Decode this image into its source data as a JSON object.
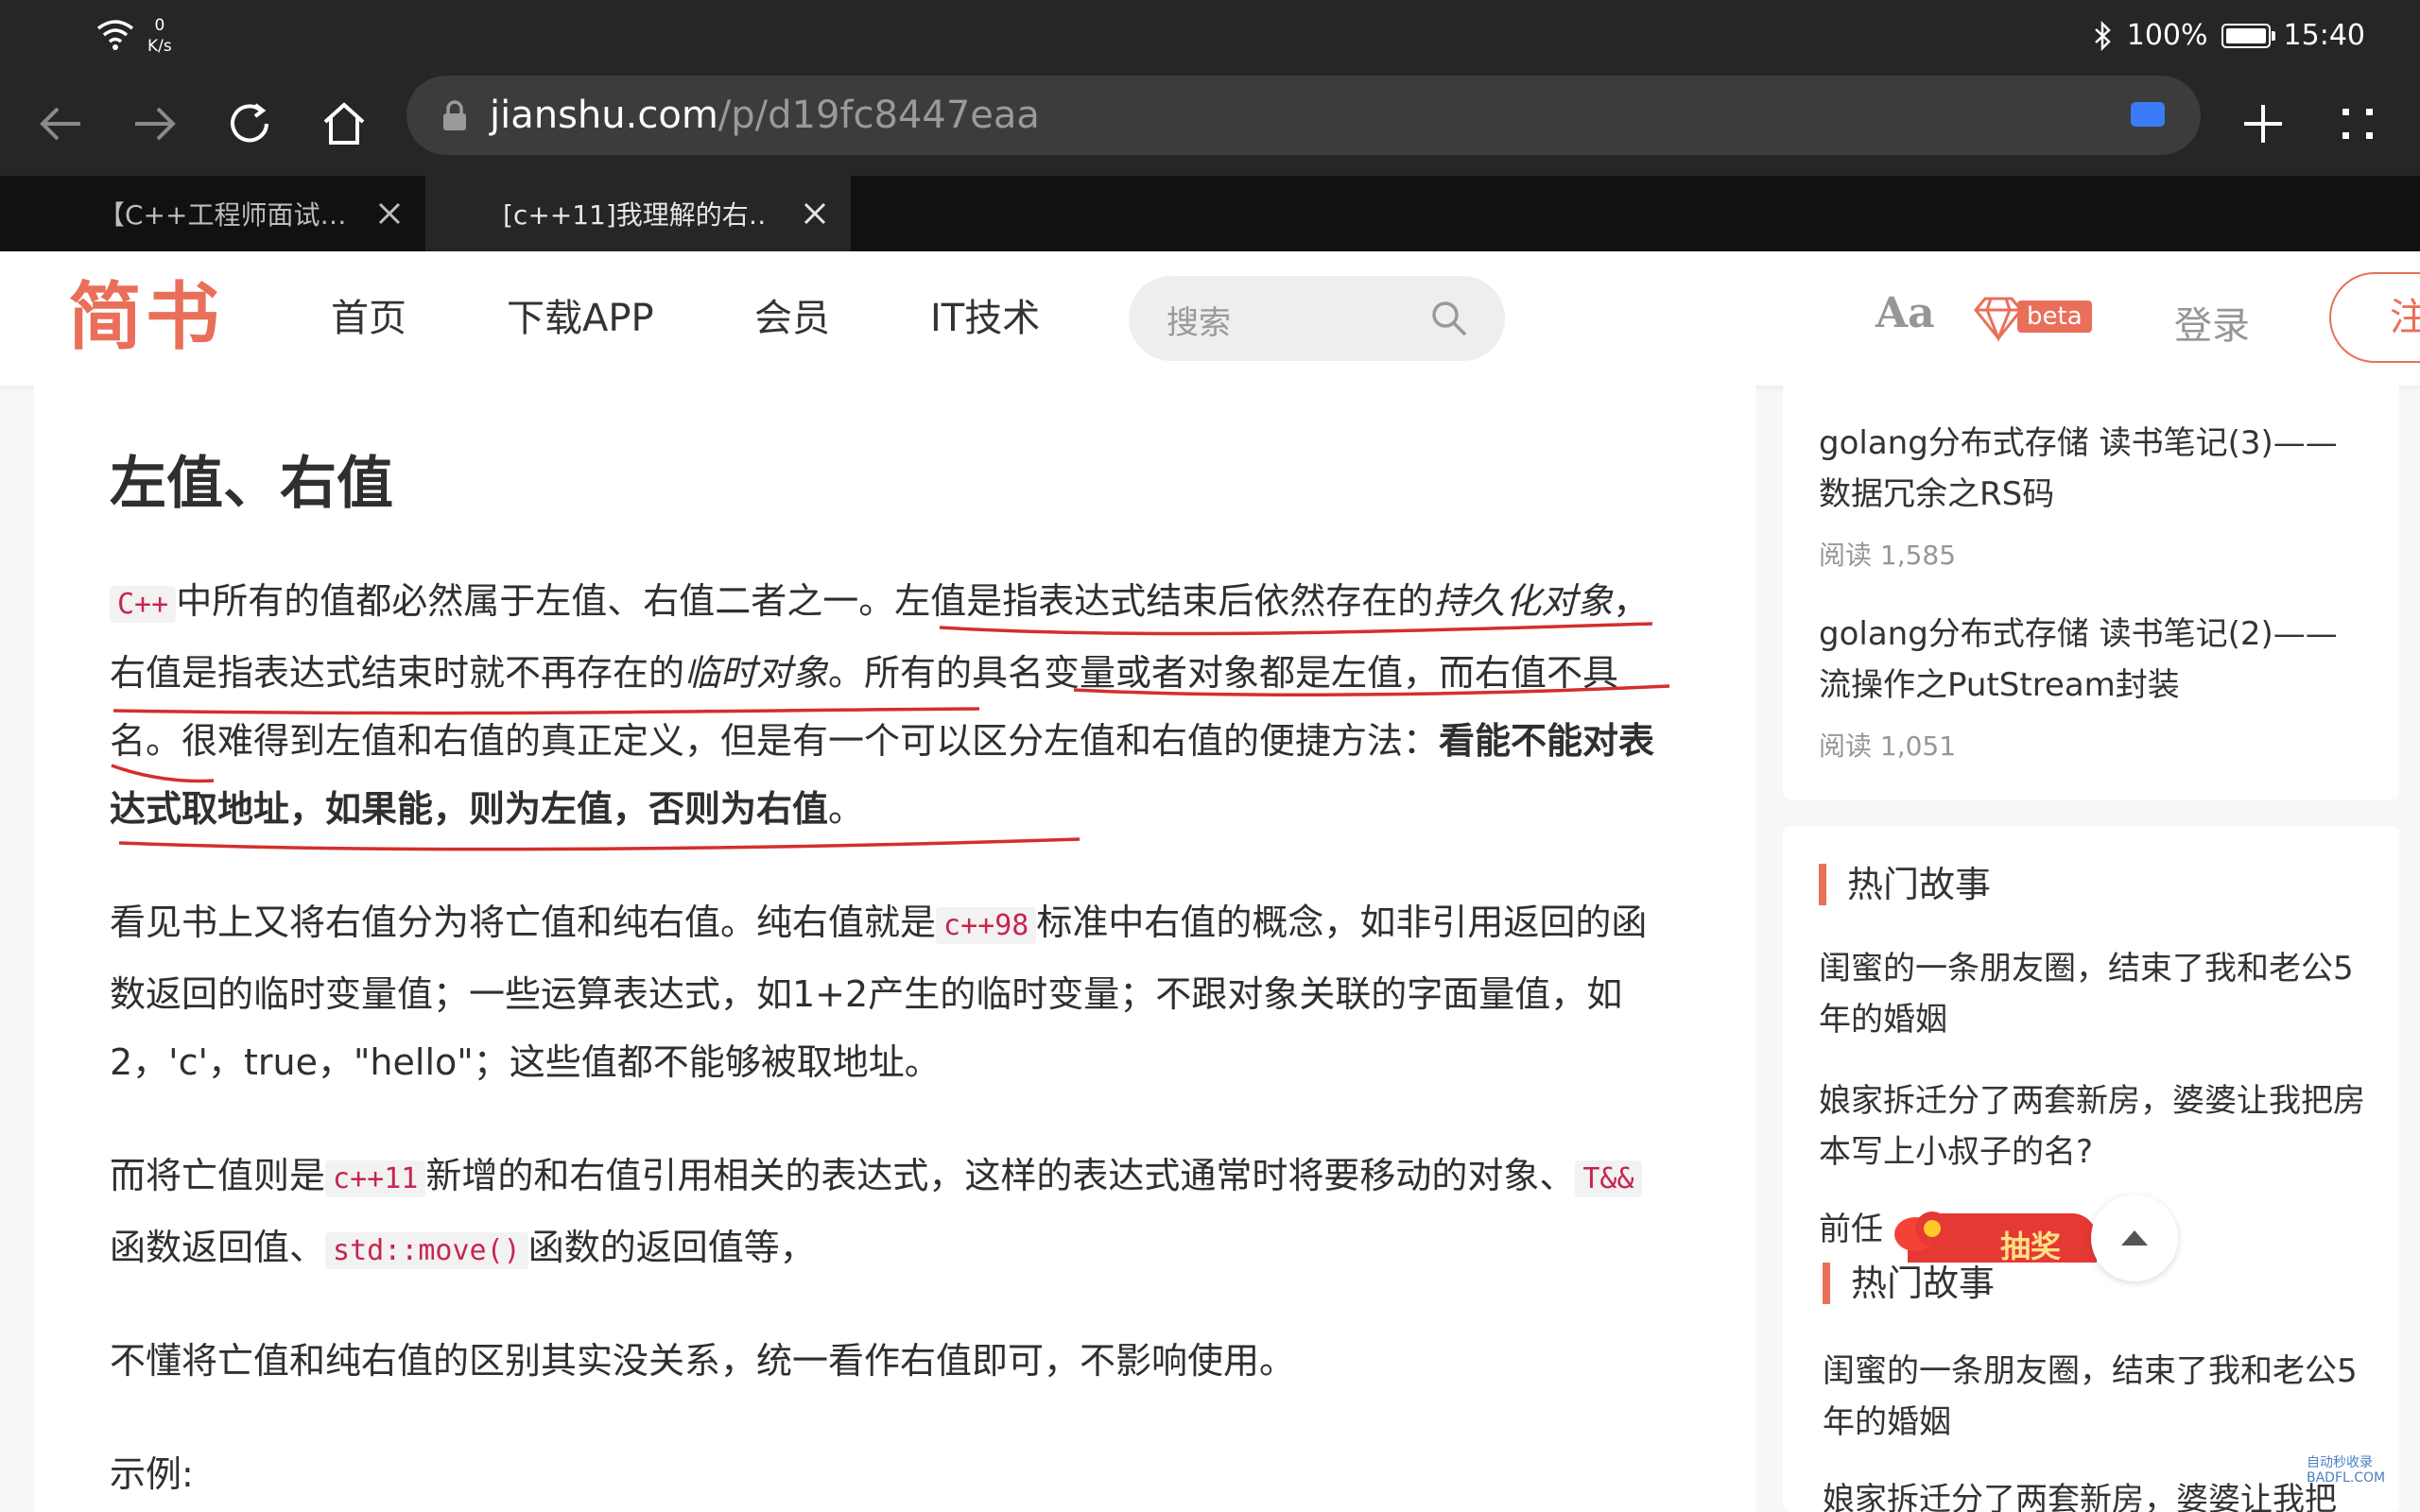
{
  "status_bar": {
    "net_speed_value": "0",
    "net_speed_unit": "K/s",
    "battery": "100%",
    "battery_level": 1.0,
    "time": "15:40"
  },
  "browser": {
    "url_domain": "jianshu.com",
    "url_path": "/p/d19fc8447eaa",
    "tabs": [
      {
        "label": "【C++工程师面试…"
      },
      {
        "label": "[c++11]我理解的右…"
      }
    ]
  },
  "site": {
    "logo": "简书",
    "nav": [
      "首页",
      "下载APP",
      "会员",
      "IT技术"
    ],
    "search_placeholder": "搜索",
    "font_toggle": "Aa",
    "beta": "beta",
    "login": "登录",
    "register": "注册"
  },
  "article": {
    "heading": "左值、右值",
    "p1": {
      "code1": "C++",
      "t1": "中所有的值都必然属于左值、右值二者之一。左值是指表达式结束后依然存在的",
      "i1": "持久化对象",
      "t2": "，右值是指表达式结束时就不再存在的",
      "i2": "临时对象",
      "t3": "。所有的具名变量或者对象都是左值，而右值不具名。很难得到左值和右值的真正定义，但是有一个可以区分左值和右值的便捷方法：",
      "b1": "看能不能对表达式取地址，如果能，则为左值，否则为右值",
      "t4": "。"
    },
    "p2": {
      "t1": "看见书上又将右值分为将亡值和纯右值。纯右值就是",
      "code1": "c++98",
      "t2": "标准中右值的概念，如非引用返回的函数返回的临时变量值；一些运算表达式，如1+2产生的临时变量；不跟对象关联的字面量值，如2，'c'，true，\"hello\"；这些值都不能够被取地址。"
    },
    "p3": {
      "t1": "而将亡值则是",
      "code1": "c++11",
      "t2": "新增的和右值引用相关的表达式，这样的表达式通常时将要移动的对象、",
      "code2": "T&&",
      "t3": "函数返回值、",
      "code3": "std::move()",
      "t4": "函数的返回值等，"
    },
    "p4": "不懂将亡值和纯右值的区别其实没关系，统一看作右值即可，不影响使用。",
    "p5": "示例:"
  },
  "sidebar": {
    "related": [
      {
        "title": "golang分布式存储 读书笔记(3)——数据冗余之RS码",
        "reads": "阅读 1,585"
      },
      {
        "title": "golang分布式存储 读书笔记(2)——流操作之PutStream封装",
        "reads": "阅读 1,051"
      }
    ],
    "section_title": "热门故事",
    "stories": [
      "闺蜜的一条朋友圈，结束了我和老公5年的婚姻",
      "娘家拆迁分了两套新房，婆婆让我把房本写上小叔子的名?",
      "前任"
    ],
    "section_title_2": "热门故事",
    "stories_2": [
      "闺蜜的一条朋友圈，结束了我和老公5年的婚姻",
      "娘家拆迁分了两套新房，婆婆让我把"
    ],
    "lucky_draw": "抽奖"
  },
  "watermark": [
    "自动秒收录",
    "BADFL.COM"
  ],
  "colors": {
    "brand": "#ea6f5a",
    "annotation": "#d32f2f",
    "code": "#c7254e"
  }
}
